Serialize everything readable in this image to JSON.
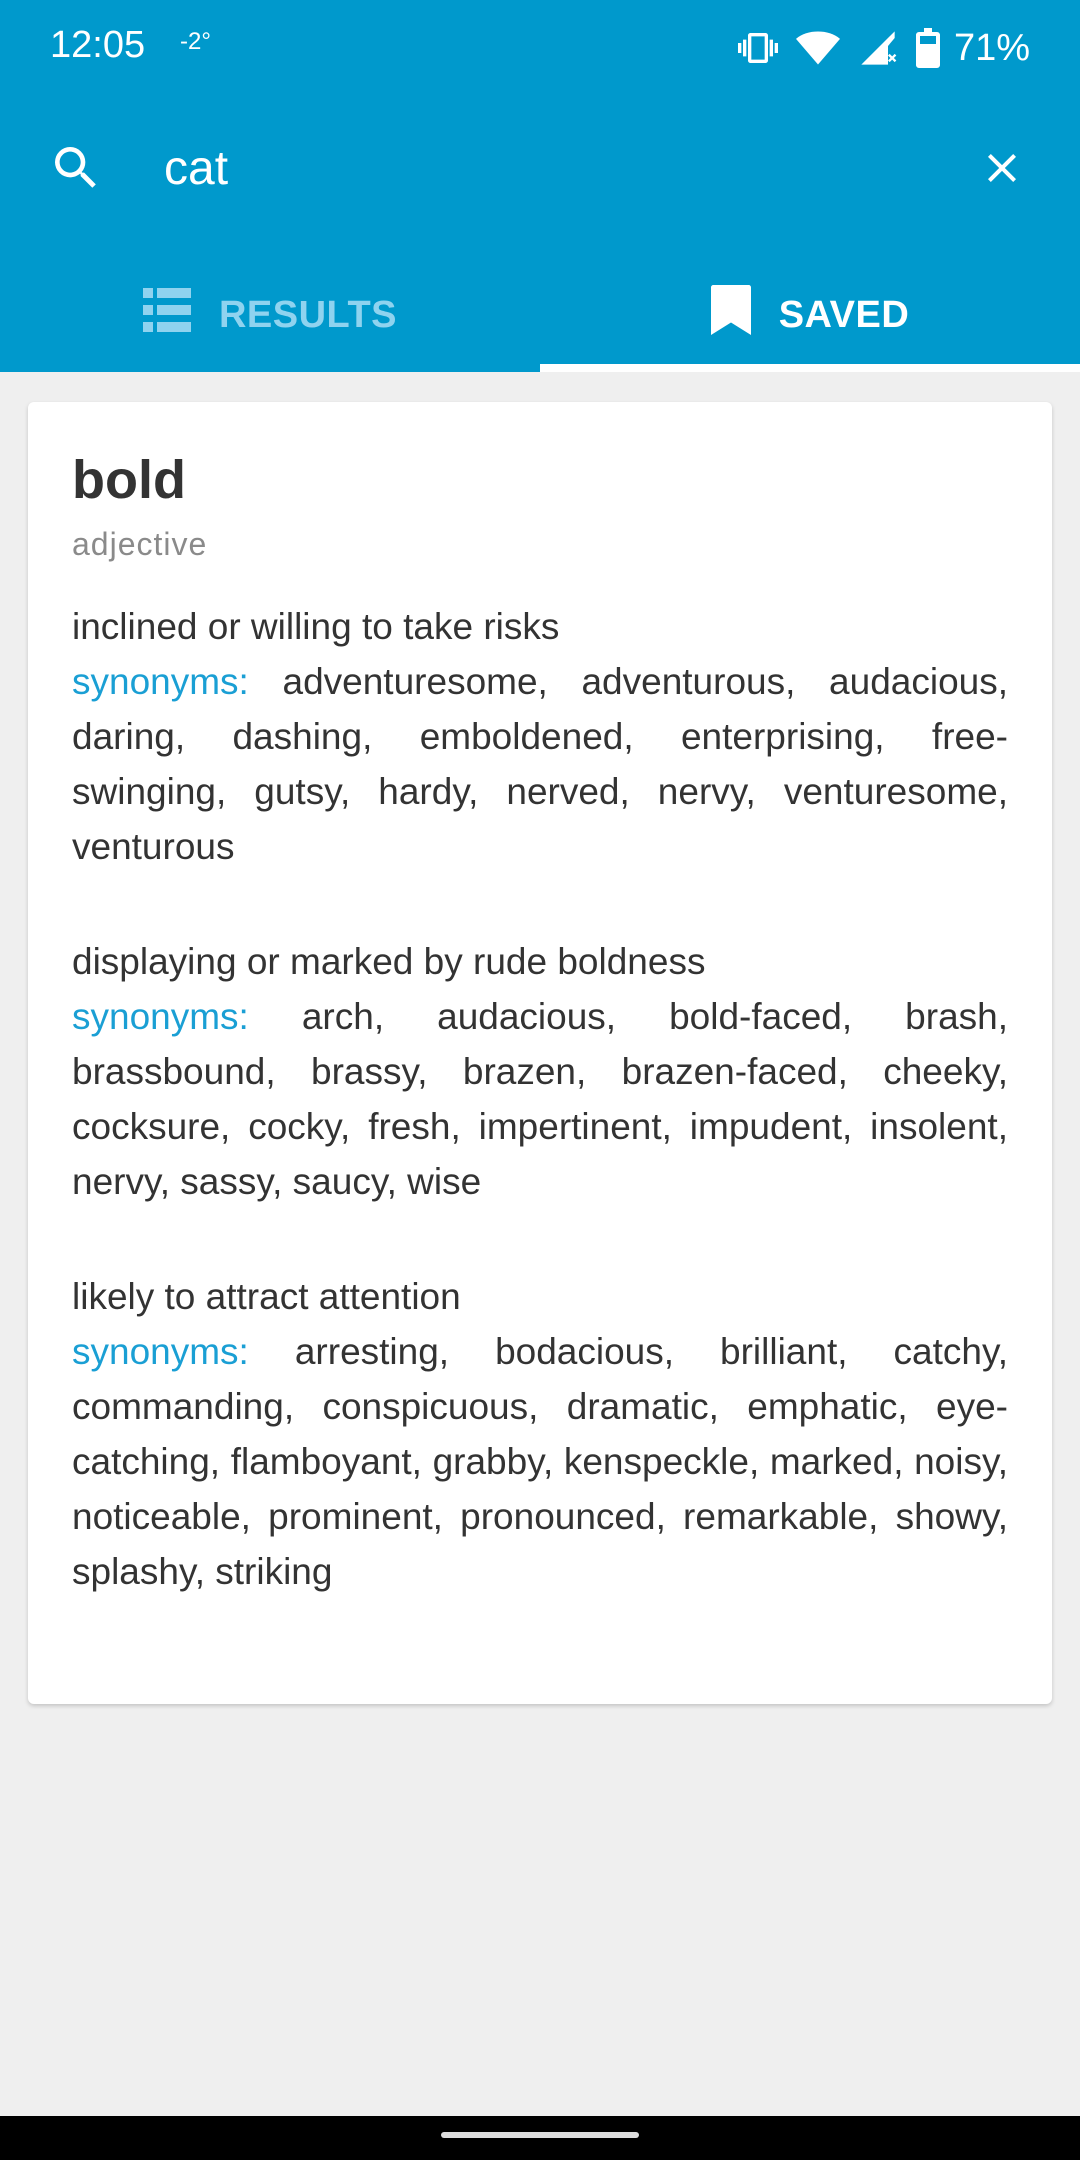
{
  "status_bar": {
    "time": "12:05",
    "temperature": "-2°",
    "battery": "71%"
  },
  "search": {
    "query": "cat",
    "placeholder": ""
  },
  "tabs": [
    {
      "label": "RESULTS",
      "icon": "list-icon",
      "active": false
    },
    {
      "label": "SAVED",
      "icon": "bookmark-icon",
      "active": true
    }
  ],
  "entry": {
    "word": "bold",
    "part_of_speech": "adjective",
    "synonyms_label": "synonyms:",
    "senses": [
      {
        "definition": "inclined or willing to take risks",
        "synonyms": "adventuresome, adventurous, audacious, daring, dashing, emboldened, enterprising, free-swinging, gutsy, hardy, nerved, nervy, venturesome, venturous"
      },
      {
        "definition": "displaying or marked by rude boldness",
        "synonyms": "arch, audacious, bold-faced, brash, brassbound, brassy, brazen, brazen-faced, cheeky, cocksure, cocky, fresh, impertinent, impudent, insolent, nervy, sassy, saucy, wise"
      },
      {
        "definition": "likely to attract attention",
        "synonyms": "arresting, bodacious, brilliant, catchy, commanding, conspicuous, dramatic, emphatic, eye-catching, flamboyant, grabby, kenspeckle, marked, noisy, noticeable, prominent, pronounced, remarkable, showy, splashy, striking"
      }
    ]
  },
  "colors": {
    "app_bar": "#0099cc",
    "accent": "#1a9fd4",
    "background": "#efefef"
  }
}
